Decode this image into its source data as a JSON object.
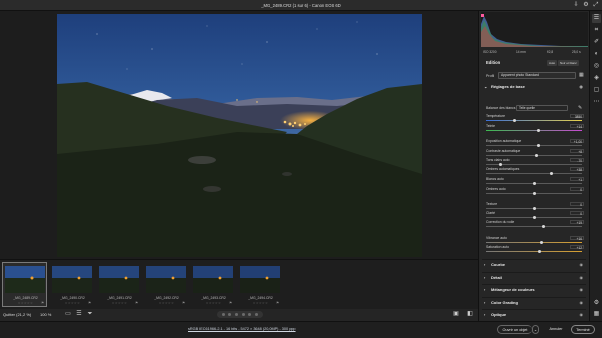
{
  "window": {
    "title": "_MG_2489.CR2 (1 sur 6) - Canon EOS 6D"
  },
  "titlebar_icons": [
    "save-icon",
    "gear-icon",
    "expand-icon"
  ],
  "filmstrip": {
    "thumbnails": [
      {
        "name": "_MG_2489.CR2",
        "stars": "☆☆☆☆☆",
        "flag": "⚑",
        "selected": true
      },
      {
        "name": "_MG_2490.CR2",
        "stars": "☆☆☆☆☆",
        "flag": "⚑",
        "selected": false
      },
      {
        "name": "_MG_2491.CR2",
        "stars": "☆☆☆☆☆",
        "flag": "⚑",
        "selected": false
      },
      {
        "name": "_MG_2492.CR2",
        "stars": "☆☆☆☆☆",
        "flag": "⚑",
        "selected": false
      },
      {
        "name": "_MG_2493.CR2",
        "stars": "☆☆☆☆☆",
        "flag": "⚑",
        "selected": false
      },
      {
        "name": "_MG_2494.CR2",
        "stars": "☆☆☆☆☆",
        "flag": "⚑",
        "selected": false
      }
    ]
  },
  "statusbar": {
    "quit_label": "Quitter (21,2 %)",
    "zoom_label": "100 %"
  },
  "footer": {
    "image_info": "sRGB IEC61966-2.1 - 16 bits - 5472 × 3648 (20,0MP) - 300 ppp",
    "open_label": "Ouvrir un objet",
    "cancel_label": "Annuler",
    "done_label": "Terminé"
  },
  "histogram_info": {
    "iso": "ISO 3200",
    "focal": "14 mm",
    "aperture": "f/2,8",
    "shutter": "25,0 s"
  },
  "edit_panel": {
    "title": "Edition",
    "auto_label": "Auto",
    "bw_label": "Noir et blanc",
    "profile_label": "Profil",
    "profile_value": "Apparent photo Standard",
    "basic_title": "Réglages de base",
    "wb_label": "Balance des blancs",
    "wb_value": "Telle quelle",
    "sliders": [
      {
        "label": "Température",
        "value": "3850",
        "pos": 0.3
      },
      {
        "label": "Teinte",
        "value": "+14",
        "pos": 0.55
      },
      {
        "label": "Exposition automatique",
        "value": "+1,00",
        "pos": 0.55
      },
      {
        "label": "Contraste automatique",
        "value": "+8",
        "pos": 0.53
      },
      {
        "label": "Tons clairs auto",
        "value": "-70",
        "pos": 0.15
      },
      {
        "label": "Ombres automatiques",
        "value": "+38",
        "pos": 0.68
      },
      {
        "label": "Blancs auto",
        "value": "+1",
        "pos": 0.5
      },
      {
        "label": "Ombres auto",
        "value": "0",
        "pos": 0.5
      },
      {
        "label": "Texture",
        "value": "0",
        "pos": 0.5
      },
      {
        "label": "Clarté",
        "value": "0",
        "pos": 0.5
      },
      {
        "label": "Correction du voile",
        "value": "+19",
        "pos": 0.6
      },
      {
        "label": "Vibrance auto",
        "value": "+16",
        "pos": 0.58
      },
      {
        "label": "Saturation auto",
        "value": "+12",
        "pos": 0.56
      }
    ],
    "collapsed_sections": [
      "Courbe",
      "Détail",
      "Mélangeur de couleurs",
      "Color Grading",
      "Optique",
      "Géométrie"
    ]
  },
  "colors": {
    "panel_bg": "#262626",
    "accent_sky": "#2e5fa3",
    "city_lights": "#f0a030"
  }
}
